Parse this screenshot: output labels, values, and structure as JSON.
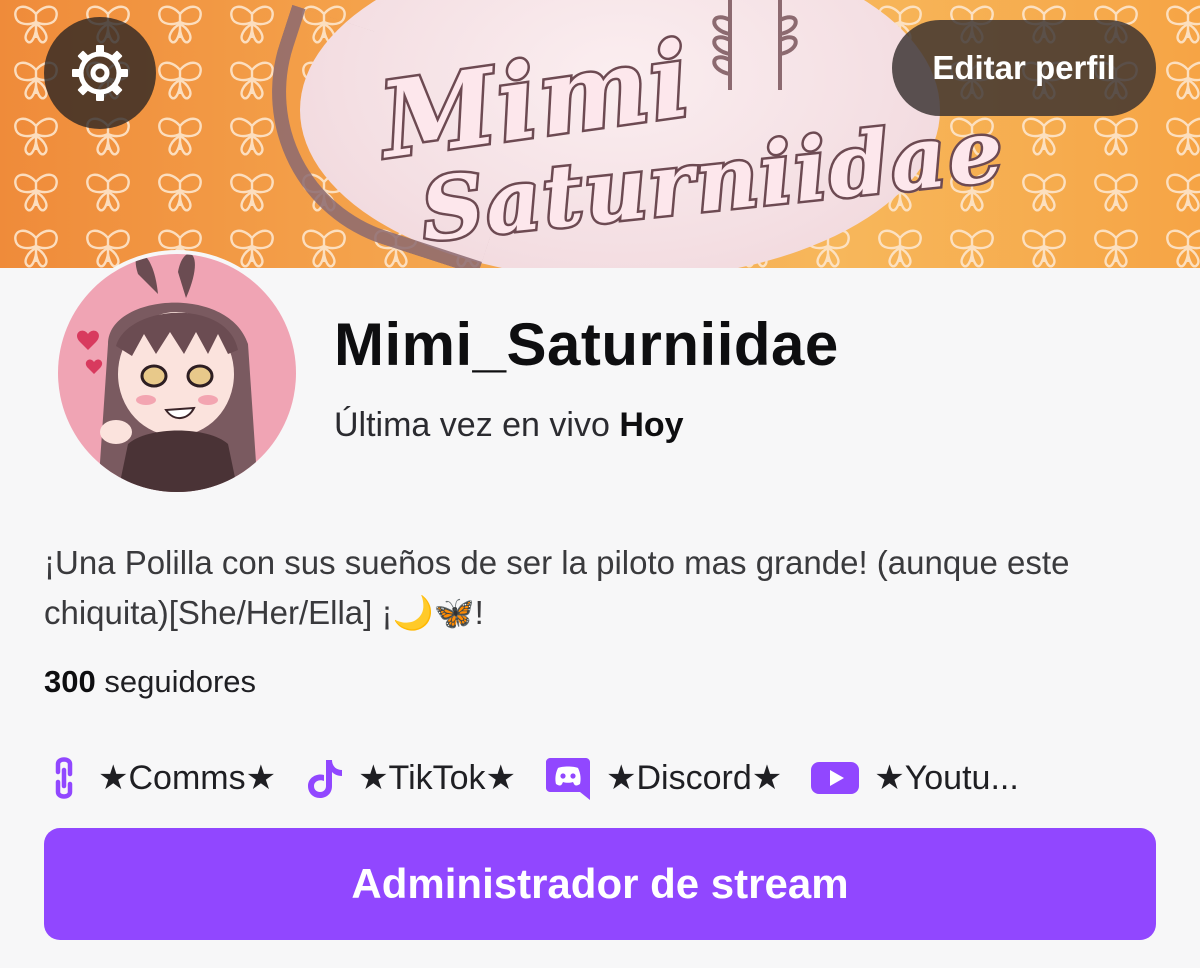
{
  "banner": {
    "logo_line1": "Mimi",
    "logo_line2": "Saturniidae"
  },
  "header": {
    "settings_icon": "gear-icon",
    "edit_profile_label": "Editar perfil"
  },
  "profile": {
    "username": "Mimi_Saturniidae",
    "last_live_prefix": "Última vez en vivo",
    "last_live_value": "Hoy",
    "bio": "¡Una Polilla con sus sueños de ser la piloto mas grande! (aunque este chiquita)[She/Her/Ella] ¡🌙🦋!",
    "followers_count": "300",
    "followers_label": "seguidores"
  },
  "links": [
    {
      "icon": "link-icon",
      "label": "★Comms★"
    },
    {
      "icon": "tiktok-icon",
      "label": "★TikTok★"
    },
    {
      "icon": "discord-icon",
      "label": "★Discord★"
    },
    {
      "icon": "youtube-icon",
      "label": "★Youtu..."
    }
  ],
  "actions": {
    "stream_manager_label": "Administrador de stream"
  },
  "colors": {
    "accent": "#9147ff",
    "banner_orange": "#f4a24b"
  }
}
